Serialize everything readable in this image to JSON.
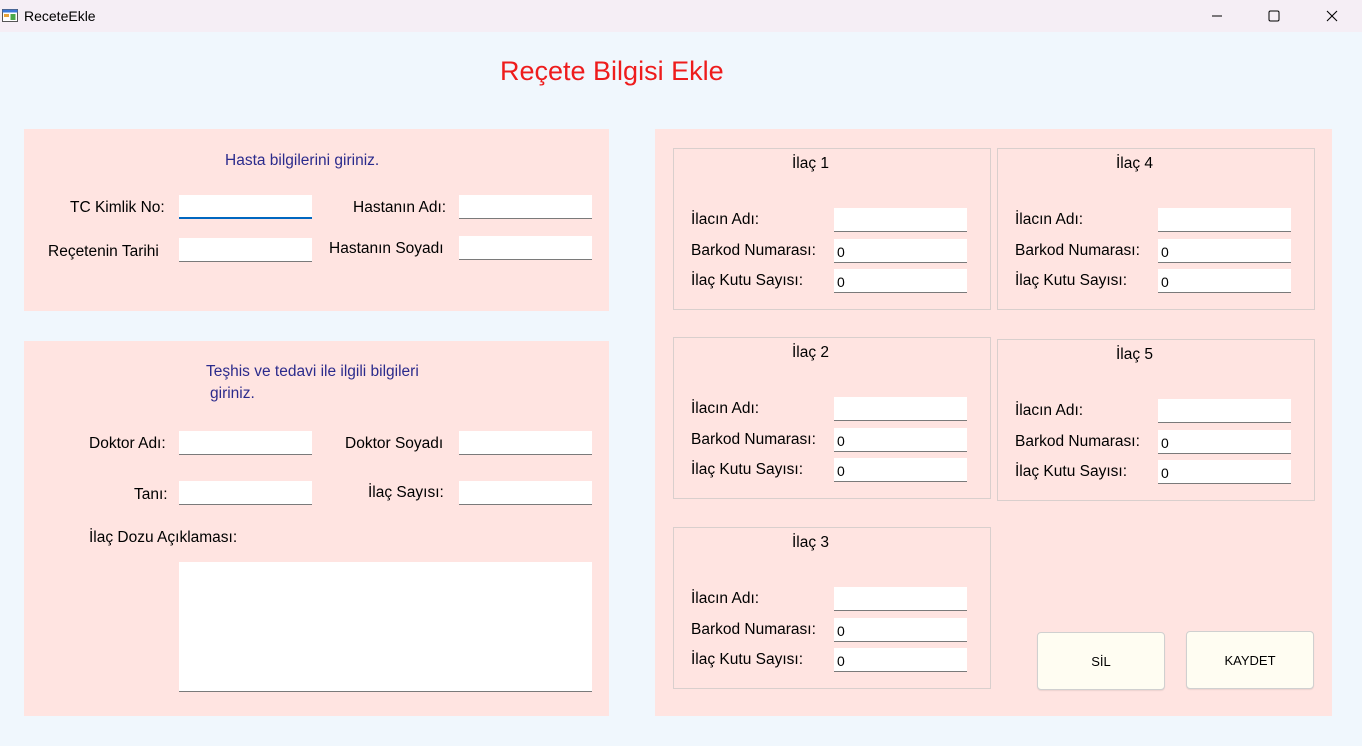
{
  "window": {
    "title": "ReceteEkle",
    "icon": "windows-forms-app-icon",
    "controls": [
      "minimize-icon",
      "maximize-icon",
      "close-icon"
    ]
  },
  "page_title": "Reçete Bilgisi Ekle",
  "patient_section": {
    "heading": "Hasta bilgilerini giriniz.",
    "tc_label": "TC Kimlik No:",
    "tc_value": "",
    "date_label": "Reçetenin Tarihi",
    "date_value": "",
    "name_label": "Hastanın Adı:",
    "name_value": "",
    "surname_label": "Hastanın Soyadı",
    "surname_value": ""
  },
  "diagnosis_section": {
    "heading_line1": "Teşhis ve tedavi ile ilgili bilgileri",
    "heading_line2": "giriniz.",
    "doctor_name_label": "Doktor Adı:",
    "doctor_name_value": "",
    "doctor_surname_label": "Doktor Soyadı",
    "doctor_surname_value": "",
    "diagnosis_label": "Tanı:",
    "diagnosis_value": "",
    "drug_count_label": "İlaç Sayısı:",
    "drug_count_value": "",
    "dose_label": "İlaç Dozu Açıklaması:",
    "dose_value": ""
  },
  "drugs": {
    "name_label": "İlacın Adı:",
    "barcode_label": "Barkod Numarası:",
    "box_label": "İlaç Kutu Sayısı:",
    "items": [
      {
        "title": "İlaç 1",
        "name": "",
        "barcode": "0",
        "boxes": "0"
      },
      {
        "title": "İlaç 2",
        "name": "",
        "barcode": "0",
        "boxes": "0"
      },
      {
        "title": "İlaç 3",
        "name": "",
        "barcode": "0",
        "boxes": "0"
      },
      {
        "title": "İlaç 4",
        "name": "",
        "barcode": "0",
        "boxes": "0"
      },
      {
        "title": "İlaç 5",
        "name": "",
        "barcode": "0",
        "boxes": "0"
      }
    ]
  },
  "buttons": {
    "delete": "SİL",
    "save": "KAYDET"
  },
  "colors": {
    "title": "#ee1c1c",
    "panel": "#ffe4e1",
    "section_heading": "#2b2b8c",
    "background": "#f0f7fd",
    "button": "#fffdf2",
    "focus": "#0067c0"
  }
}
